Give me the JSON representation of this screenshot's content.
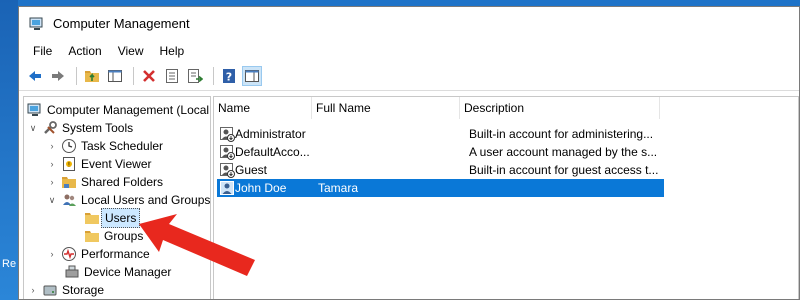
{
  "window": {
    "title": "Computer Management"
  },
  "desktop": {
    "edge_text": "Re"
  },
  "menu": [
    "File",
    "Action",
    "View",
    "Help"
  ],
  "toolbar": {
    "buttons": [
      "back-icon",
      "forward-icon",
      "up-folder-icon",
      "show-hide-tree-icon",
      "delete-icon",
      "properties-icon",
      "export-list-icon",
      "help-icon",
      "show-hide-action-pane-icon"
    ]
  },
  "tree": {
    "items": [
      {
        "label": "Computer Management (Local",
        "icon": "computer-management-icon",
        "level": 0,
        "caret": ""
      },
      {
        "label": "System Tools",
        "icon": "tools-icon",
        "level": 1,
        "caret": "expanded"
      },
      {
        "label": "Task Scheduler",
        "icon": "clock-icon",
        "level": 2,
        "caret": "collapsed"
      },
      {
        "label": "Event Viewer",
        "icon": "event-viewer-icon",
        "level": 2,
        "caret": "collapsed"
      },
      {
        "label": "Shared Folders",
        "icon": "shared-folder-icon",
        "level": 2,
        "caret": "collapsed"
      },
      {
        "label": "Local Users and Groups",
        "icon": "users-groups-icon",
        "level": 2,
        "caret": "expanded"
      },
      {
        "label": "Users",
        "icon": "folder-icon",
        "level": 3,
        "caret": "",
        "selected": true
      },
      {
        "label": "Groups",
        "icon": "folder-icon",
        "level": 3,
        "caret": ""
      },
      {
        "label": "Performance",
        "icon": "performance-icon",
        "level": 2,
        "caret": "collapsed"
      },
      {
        "label": "Device Manager",
        "icon": "device-manager-icon",
        "level": 2,
        "caret": ""
      },
      {
        "label": "Storage",
        "icon": "storage-icon",
        "level": 1,
        "caret": "collapsed"
      }
    ]
  },
  "list": {
    "columns": [
      "Name",
      "Full Name",
      "Description"
    ],
    "rows": [
      {
        "name": "Administrator",
        "full_name": "",
        "description": "Built-in account for administering...",
        "disabled": true
      },
      {
        "name": "DefaultAcco...",
        "full_name": "",
        "description": "A user account managed by the s...",
        "disabled": true
      },
      {
        "name": "Guest",
        "full_name": "",
        "description": "Built-in account for guest access t...",
        "disabled": true
      },
      {
        "name": "John Doe",
        "full_name": "Tamara",
        "description": "",
        "selected": true
      }
    ]
  },
  "colors": {
    "accent": "#0a78d7",
    "arrow": "#e8281e",
    "desktop": "#1e73c8"
  }
}
